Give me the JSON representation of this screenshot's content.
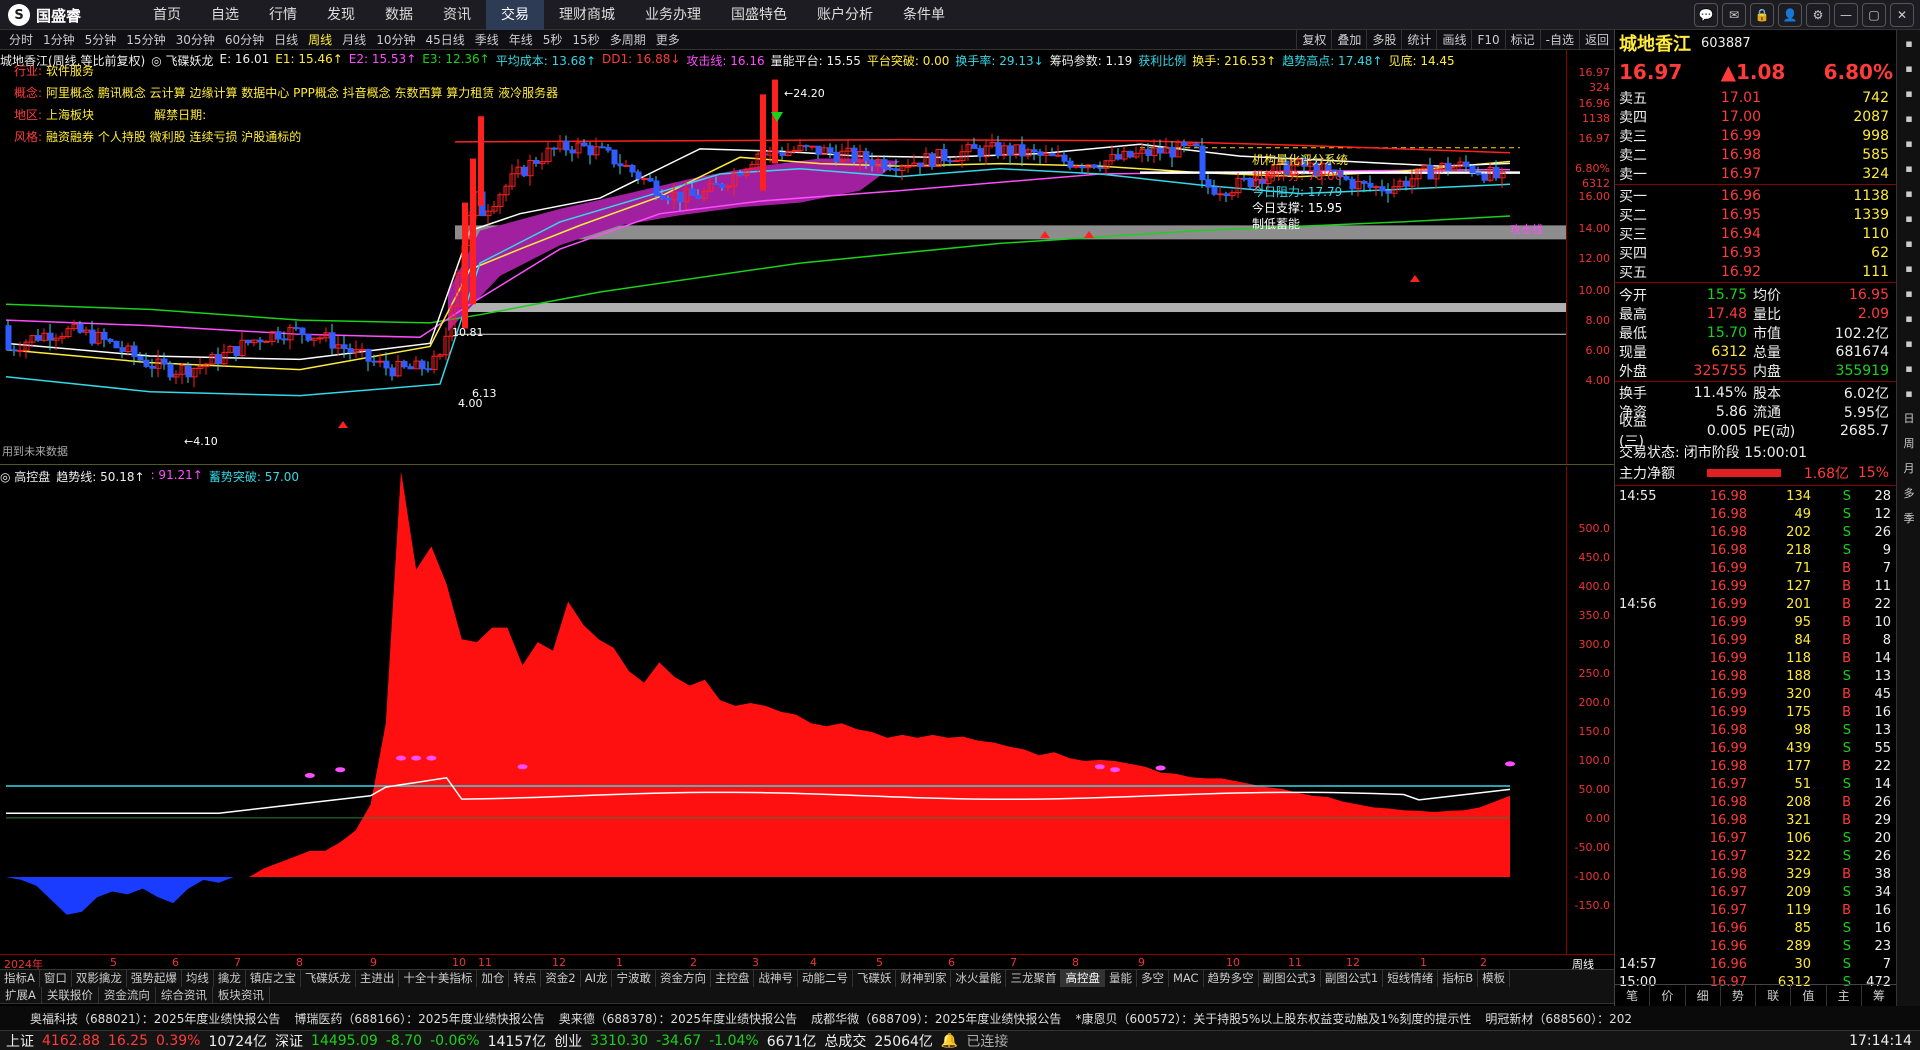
{
  "app": {
    "logo": "国盛睿",
    "logo_mark": "S"
  },
  "nav": [
    "首页",
    "自选",
    "行情",
    "发现",
    "数据",
    "资讯",
    "交易",
    "理财商城",
    "业务办理",
    "国盛特色",
    "账户分析",
    "条件单"
  ],
  "window_icons": [
    "chat-icon",
    "mail-icon",
    "lock-icon",
    "user-icon",
    "settings-icon",
    "minimize-icon",
    "maximize-icon",
    "close-icon"
  ],
  "periods": [
    "分时",
    "1分钟",
    "5分钟",
    "15分钟",
    "30分钟",
    "60分钟",
    "日线",
    "周线",
    "月线",
    "10分钟",
    "45日线",
    "季线",
    "年线",
    "5秒",
    "15秒",
    "多周期",
    "更多"
  ],
  "periods_active": "周线",
  "tools": [
    "复权",
    "叠加",
    "多股",
    "统计",
    "画线",
    "F10",
    "标记",
    "-自选",
    "返回"
  ],
  "main": {
    "header": [
      {
        "t": "城地香江(周线,等比前复权)",
        "c": "white"
      },
      {
        "t": "◎ 飞碟妖龙",
        "c": "white"
      },
      {
        "t": "E: 16.01",
        "c": "white"
      },
      {
        "t": "E1: 15.46↑",
        "c": "yellow"
      },
      {
        "t": "E2: 15.53↑",
        "c": "magenta"
      },
      {
        "t": "E3: 12.36↑",
        "c": "green"
      },
      {
        "t": "平均成本: 13.68↑",
        "c": "cyan"
      },
      {
        "t": "DD1: 16.88↓",
        "c": "red"
      },
      {
        "t": "攻击线: 16.16",
        "c": "magenta"
      },
      {
        "t": "量能平台: 15.55",
        "c": "white"
      },
      {
        "t": "平台突破: 0.00",
        "c": "yellow"
      },
      {
        "t": "换手率: 29.13↓",
        "c": "cyan"
      },
      {
        "t": "筹码参数: 1.19",
        "c": "white"
      },
      {
        "t": "获利比例",
        "c": "cyan"
      },
      {
        "t": "换手: 216.53↑",
        "c": "yellow"
      },
      {
        "t": "趋势高点: 17.48↑",
        "c": "cyan"
      },
      {
        "t": "见底: 14.45",
        "c": "yellow"
      }
    ],
    "info": [
      {
        "k": "行业:",
        "v": "软件服务"
      },
      {
        "k": "概念:",
        "v": "阿里概念 鹏讯概念 云计算 边缘计算 数据中心 PPP概念 抖音概念 东数西算 算力租赁 液冷服务器"
      },
      {
        "k": "地区:",
        "v": "上海板块",
        "k2": "解禁日期:",
        "v2": ""
      },
      {
        "k": "风格:",
        "v": "融资融券 个人持股 微利股 连续亏损 沪股通标的"
      }
    ],
    "yticks": [
      "16.97",
      "324",
      "16.96",
      "1138",
      "16.97",
      "6.80%",
      "6312",
      "16.00",
      "14.00",
      "12.00",
      "10.00",
      "8.00",
      "6.00",
      "4.00"
    ],
    "annotations": {
      "high": "24.20",
      "low": "4.10",
      "mid1": "10.81",
      "mid2": "6.13",
      "mid3": "4.00",
      "attack": "攻击线",
      "future": "用到未来数据",
      "score_title": "机构量化评分系统",
      "score": "机构评分: 70.00",
      "resist": "今日阻力: 17.79",
      "support": "今日支撑: 15.95",
      "status": "制低蓄能"
    }
  },
  "sub": {
    "header": [
      {
        "t": "◎ 高控盘",
        "c": "white"
      },
      {
        "t": "趋势线: 50.18↑",
        "c": "white"
      },
      {
        "t": ": 91.21↑",
        "c": "magenta"
      },
      {
        "t": "蓄势突破: 57.00",
        "c": "cyan"
      }
    ],
    "yticks": [
      "500.0",
      "450.0",
      "400.0",
      "350.0",
      "300.0",
      "250.0",
      "200.0",
      "150.0",
      "100.0",
      "50.00",
      "0.00",
      "-50.00",
      "-100.0",
      "-150.0"
    ]
  },
  "chart_data": [
    {
      "type": "candlestick",
      "title": "城地香江(周线,等比前复权)",
      "ylim": [
        4,
        26
      ],
      "annotations": [
        "24.20",
        "4.10"
      ],
      "series": [
        {
          "name": "E",
          "last": 16.01
        },
        {
          "name": "E1",
          "last": 15.46
        },
        {
          "name": "E2",
          "last": 15.53
        },
        {
          "name": "E3",
          "last": 12.36
        }
      ]
    },
    {
      "type": "area",
      "title": "高控盘",
      "ylim": [
        -150,
        550
      ],
      "x": [
        0,
        1,
        2,
        3,
        4,
        5,
        6,
        7,
        8,
        9,
        10,
        11,
        12,
        13,
        14,
        15,
        16,
        17,
        18,
        19,
        20,
        21,
        22,
        23,
        24,
        25,
        26,
        27,
        28,
        29,
        30,
        31,
        32,
        33,
        34,
        35,
        36,
        37,
        38,
        39,
        40,
        41,
        42,
        43,
        44,
        45,
        46,
        47,
        48,
        49,
        50,
        51,
        52,
        53,
        54,
        55,
        56,
        57,
        58,
        59,
        60,
        61,
        62,
        63,
        64,
        65,
        66,
        67,
        68,
        69,
        70,
        71,
        72,
        73,
        74,
        75,
        76,
        77,
        78,
        79,
        80,
        81,
        82,
        83,
        84,
        85,
        86,
        87,
        88,
        89,
        90,
        91,
        92,
        93,
        94,
        95,
        96,
        97,
        98,
        99
      ],
      "values": [
        -100,
        -105,
        -115,
        -140,
        -165,
        -160,
        -135,
        -125,
        -130,
        -120,
        -135,
        -145,
        -120,
        -105,
        -110,
        -100,
        -100,
        -85,
        -75,
        -65,
        -55,
        -55,
        -40,
        -20,
        25,
        165,
        600,
        430,
        470,
        405,
        310,
        305,
        330,
        330,
        265,
        305,
        290,
        375,
        335,
        310,
        295,
        255,
        235,
        270,
        245,
        230,
        240,
        205,
        195,
        200,
        195,
        185,
        180,
        165,
        160,
        165,
        155,
        150,
        140,
        145,
        140,
        145,
        140,
        142,
        135,
        132,
        125,
        120,
        110,
        115,
        105,
        100,
        102,
        100,
        95,
        90,
        80,
        78,
        72,
        70,
        70,
        65,
        60,
        55,
        52,
        45,
        40,
        38,
        30,
        25,
        20,
        18,
        15,
        14,
        12,
        14,
        15,
        20,
        30,
        40
      ],
      "series": [
        {
          "name": "趋势线",
          "last": 50.18
        },
        {
          "name": "蓄势突破",
          "last": 57.0
        }
      ]
    }
  ],
  "xaxis": [
    "2024年",
    "5",
    "6",
    "7",
    "8",
    "9",
    "10",
    "11",
    "12",
    "1",
    "2",
    "3",
    "4",
    "5",
    "6",
    "7",
    "8",
    "9",
    "10",
    "11",
    "12",
    "1",
    "2"
  ],
  "xaxis_right": "周线",
  "indicator_tabs": [
    "指标A",
    "窗口",
    "双影擒龙",
    "强势起爆",
    "均线",
    "擒龙",
    "镇店之宝",
    "飞碟妖龙",
    "主进出",
    "十全十美指标",
    "加仓",
    "转点",
    "资金2",
    "AI龙",
    "宁波敢",
    "资金方向",
    "主控盘",
    "战神号",
    "动能二号",
    "飞碟妖",
    "财神到家",
    "冰火量能",
    "三龙聚首",
    "高控盘",
    "量能",
    "多空",
    "MAC",
    "趋势多空",
    "副图公式3",
    "副图公式1",
    "短线情绪",
    "指标B",
    "模板"
  ],
  "indicator_active": "高控盘",
  "ext_tabs": [
    "扩展A",
    "关联报价",
    "资金流向",
    "综合资讯",
    "板块资讯"
  ],
  "news": [
    "奥福科技（688021）：2025年度业绩快报公告",
    "博瑞医药（688166）：2025年度业绩快报公告",
    "奥来德（688378）：2025年度业绩快报公告",
    "成都华微（688709）：2025年度业绩快报公告",
    "*康恩贝（600572）：关于持股5%以上股东权益变动触及1%刻度的提示性",
    "明冠新材（688560）：202"
  ],
  "status": {
    "sh_label": "上证",
    "sh_val": "4162.88",
    "sh_chg": "16.25",
    "sh_pct": "0.39%",
    "sh_amt": "10724亿",
    "sz_label": "深证",
    "sz_val": "14495.09",
    "sz_chg": "-8.70",
    "sz_pct": "-0.06%",
    "sz_amt": "14157亿",
    "cy_label": "创业",
    "cy_val": "3310.30",
    "cy_chg": "-34.67",
    "cy_pct": "-1.04%",
    "cy_amt": "6671亿",
    "total_label": "总成交",
    "total_val": "25064亿",
    "conn": "已连接",
    "time": "17:14:14"
  },
  "quote": {
    "name": "城地香江",
    "code": "603887",
    "price": "16.97",
    "chg": "▲1.08",
    "pct": "6.80%",
    "asks": [
      {
        "l": "卖五",
        "p": "17.01",
        "v": "742"
      },
      {
        "l": "卖四",
        "p": "17.00",
        "v": "2087"
      },
      {
        "l": "卖三",
        "p": "16.99",
        "v": "998"
      },
      {
        "l": "卖二",
        "p": "16.98",
        "v": "585"
      },
      {
        "l": "卖一",
        "p": "16.97",
        "v": "324"
      }
    ],
    "bids": [
      {
        "l": "买一",
        "p": "16.96",
        "v": "1138"
      },
      {
        "l": "买二",
        "p": "16.95",
        "v": "1339"
      },
      {
        "l": "买三",
        "p": "16.94",
        "v": "110"
      },
      {
        "l": "买四",
        "p": "16.93",
        "v": "62"
      },
      {
        "l": "买五",
        "p": "16.92",
        "v": "111"
      }
    ],
    "stats": [
      {
        "a": "今开",
        "b": "15.75",
        "bc": "green",
        "c": "均价",
        "d": "16.95",
        "dc": "red"
      },
      {
        "a": "最高",
        "b": "17.48",
        "bc": "red",
        "c": "量比",
        "d": "2.09",
        "dc": "red"
      },
      {
        "a": "最低",
        "b": "15.70",
        "bc": "green",
        "c": "市值",
        "d": "102.2亿",
        "dc": "white"
      },
      {
        "a": "现量",
        "b": "6312",
        "bc": "yellow",
        "c": "总量",
        "d": "681674",
        "dc": "white"
      },
      {
        "a": "外盘",
        "b": "325755",
        "bc": "red",
        "c": "内盘",
        "d": "355919",
        "dc": "green"
      }
    ],
    "stats2": [
      {
        "a": "换手",
        "b": "11.45%",
        "c": "股本",
        "d": "6.02亿"
      },
      {
        "a": "净资",
        "b": "5.86",
        "c": "流通",
        "d": "5.95亿"
      },
      {
        "a": "收益(三)",
        "b": "0.005",
        "c": "PE(动)",
        "d": "2685.7"
      }
    ],
    "trade_state_label": "交易状态:",
    "trade_state": "闭市阶段 15:00:01",
    "netflow_label": "主力净额",
    "netflow_val": "1.68亿",
    "netflow_pct": "15%",
    "ticks": [
      {
        "t": "14:55",
        "p": "16.98",
        "v": "134",
        "s": "S",
        "n": "28"
      },
      {
        "t": "",
        "p": "16.98",
        "v": "49",
        "s": "S",
        "n": "12"
      },
      {
        "t": "",
        "p": "16.98",
        "v": "202",
        "s": "S",
        "n": "26"
      },
      {
        "t": "",
        "p": "16.98",
        "v": "218",
        "s": "S",
        "n": "9"
      },
      {
        "t": "",
        "p": "16.99",
        "v": "71",
        "s": "B",
        "n": "7"
      },
      {
        "t": "",
        "p": "16.99",
        "v": "127",
        "s": "B",
        "n": "11"
      },
      {
        "t": "14:56",
        "p": "16.99",
        "v": "201",
        "s": "B",
        "n": "22"
      },
      {
        "t": "",
        "p": "16.99",
        "v": "95",
        "s": "B",
        "n": "10"
      },
      {
        "t": "",
        "p": "16.99",
        "v": "84",
        "s": "B",
        "n": "8"
      },
      {
        "t": "",
        "p": "16.99",
        "v": "118",
        "s": "B",
        "n": "14"
      },
      {
        "t": "",
        "p": "16.98",
        "v": "188",
        "s": "S",
        "n": "13"
      },
      {
        "t": "",
        "p": "16.99",
        "v": "320",
        "s": "B",
        "n": "45"
      },
      {
        "t": "",
        "p": "16.99",
        "v": "175",
        "s": "B",
        "n": "16"
      },
      {
        "t": "",
        "p": "16.98",
        "v": "98",
        "s": "S",
        "n": "13"
      },
      {
        "t": "",
        "p": "16.99",
        "v": "439",
        "s": "S",
        "n": "55"
      },
      {
        "t": "",
        "p": "16.98",
        "v": "177",
        "s": "B",
        "n": "22"
      },
      {
        "t": "",
        "p": "16.97",
        "v": "51",
        "s": "S",
        "n": "14"
      },
      {
        "t": "",
        "p": "16.98",
        "v": "208",
        "s": "B",
        "n": "26"
      },
      {
        "t": "",
        "p": "16.98",
        "v": "321",
        "s": "B",
        "n": "29"
      },
      {
        "t": "",
        "p": "16.97",
        "v": "106",
        "s": "S",
        "n": "20"
      },
      {
        "t": "",
        "p": "16.97",
        "v": "322",
        "s": "S",
        "n": "26"
      },
      {
        "t": "",
        "p": "16.98",
        "v": "329",
        "s": "B",
        "n": "38"
      },
      {
        "t": "",
        "p": "16.97",
        "v": "209",
        "s": "S",
        "n": "34"
      },
      {
        "t": "",
        "p": "16.97",
        "v": "119",
        "s": "B",
        "n": "16"
      },
      {
        "t": "",
        "p": "16.96",
        "v": "85",
        "s": "S",
        "n": "16"
      },
      {
        "t": "",
        "p": "16.96",
        "v": "289",
        "s": "S",
        "n": "23"
      },
      {
        "t": "14:57",
        "p": "16.96",
        "v": "30",
        "s": "S",
        "n": "7"
      },
      {
        "t": "15:00",
        "p": "16.97",
        "v": "6312",
        "s": "S",
        "n": "472"
      }
    ],
    "rtabs": [
      "笔",
      "价",
      "细",
      "势",
      "联",
      "值",
      "主",
      "筹"
    ]
  },
  "rside": [
    "日",
    "周",
    "月",
    "多",
    "季"
  ]
}
